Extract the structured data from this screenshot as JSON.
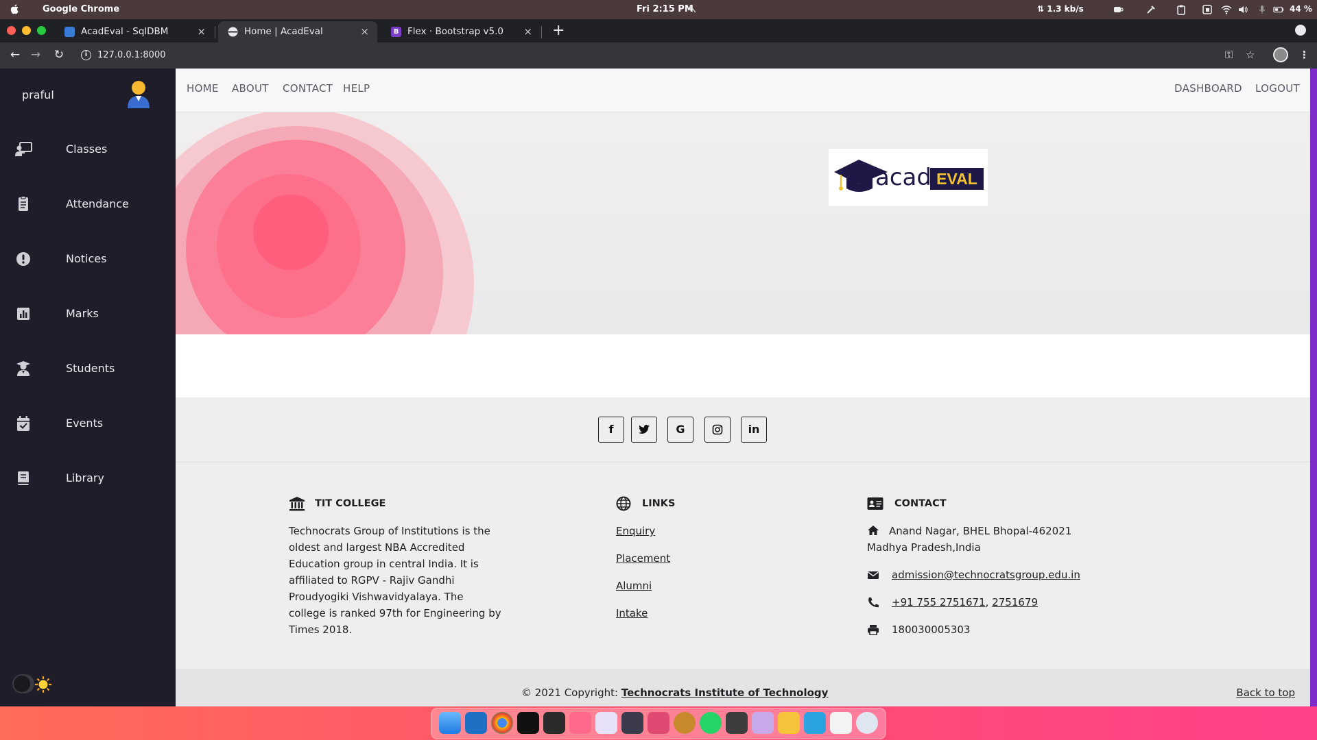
{
  "menubar": {
    "app_name": "Google Chrome",
    "clock": "Fri  2:15 PM",
    "network_speed": "1.3 kb/s",
    "battery": "44 %"
  },
  "browser": {
    "tabs": [
      {
        "title": "AcadEval - SqlDBM",
        "favicon_color": "#3a7bd5",
        "active": false
      },
      {
        "title": "Home | AcadEval",
        "favicon_color": "#e8eaed",
        "active": true
      },
      {
        "title": "Flex · Bootstrap v5.0",
        "favicon_color": "#7a3ec8",
        "favicon_letter": "B",
        "active": false
      }
    ],
    "new_tab_label": "+",
    "close_label": "×",
    "url": "127.0.0.1:8000"
  },
  "sidebar": {
    "username": "praful",
    "items": [
      {
        "label": "Classes",
        "icon": "chalkboard-teacher-icon"
      },
      {
        "label": "Attendance",
        "icon": "clipboard-icon"
      },
      {
        "label": "Notices",
        "icon": "exclamation-circle-icon"
      },
      {
        "label": "Marks",
        "icon": "bar-chart-icon"
      },
      {
        "label": "Students",
        "icon": "user-graduate-icon"
      },
      {
        "label": "Events",
        "icon": "calendar-check-icon"
      },
      {
        "label": "Library",
        "icon": "book-icon"
      }
    ]
  },
  "topnav": {
    "left": [
      "HOME",
      "ABOUT",
      "CONTACT",
      "HELP"
    ],
    "right": [
      "DASHBOARD",
      "LOGOUT"
    ]
  },
  "hero": {
    "logo_text": "acad",
    "logo_badge": "EVAL"
  },
  "social": [
    {
      "icon": "facebook-icon",
      "glyph": "f"
    },
    {
      "icon": "twitter-icon",
      "glyph": "t"
    },
    {
      "icon": "google-icon",
      "glyph": "G"
    },
    {
      "icon": "instagram-icon",
      "glyph": "◎"
    },
    {
      "icon": "linkedin-icon",
      "glyph": "in"
    }
  ],
  "footer": {
    "college": {
      "heading": "TIT COLLEGE",
      "text": "Technocrats Group of Institutions is the oldest and largest NBA Accredited Education group in central India. It is affiliated to RGPV - Rajiv Gandhi Proudyogiki Vishwavidyalaya. The college is ranked 97th for Engineering by Times 2018."
    },
    "links": {
      "heading": "LINKS",
      "items": [
        "Enquiry",
        "Placement",
        "Alumni",
        "Intake"
      ]
    },
    "contact": {
      "heading": "CONTACT",
      "address_line1": "Anand Nagar, BHEL Bhopal-462021",
      "address_line2": "Madhya Pradesh,India",
      "email": "admission@technocratsgroup.edu.in",
      "phone1": "+91 755 2751671",
      "phone_sep": ", ",
      "phone2": "2751679",
      "fax": "180030005303"
    }
  },
  "copyright": {
    "prefix": "© 2021 Copyright: ",
    "link": "Technocrats Institute of Technology",
    "back_to_top": "Back to top"
  },
  "colors": {
    "sidebar_bg": "#1f1d2a",
    "accent_purple": "#7b2cc9",
    "logo_navy": "#1d1845",
    "logo_gold": "#f2c230"
  }
}
